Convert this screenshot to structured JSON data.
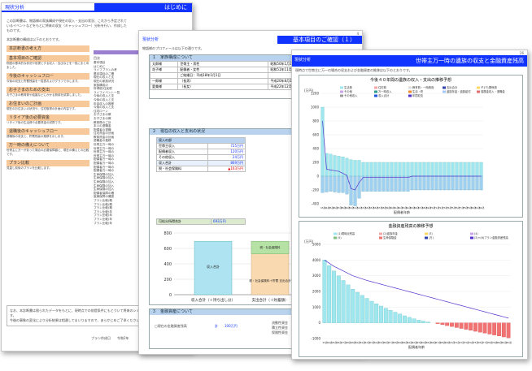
{
  "page1": {
    "tag": "現状分析",
    "title": "はじめに",
    "intro": "この診断書は、物語様の家族構成や現在の収入・支出の状況、これから予定されているイベントなどをもとに将来の収支（キャッシュフロー）分析を行い、作成したものです。",
    "toc_note": "本診断書の構成は以下のとおりです。",
    "sections": [
      {
        "h": "本診断書の考え方",
        "d": ""
      },
      {
        "h": "基本項目のご確認",
        "d": "物語の基本的な状況や前提とする収入・支出などを一覧にまとめました。"
      },
      {
        "h": "今後のキャッシュフロー",
        "d": "今後の収支と貯蓄残高を一覧表およびグラフで示します。"
      },
      {
        "h": "お子さまのための支出",
        "d": "お子さまの教育費や結婚などにかかる費用を試算しました。"
      },
      {
        "h": "お住まいのご計画",
        "d": "現在のお住まいの状況や、住宅取得の計画の内容です。"
      },
      {
        "h": "リタイア後の必要資金",
        "d": "リタイア後の生活費や必要資金の試算です。"
      },
      {
        "h": "退職後のキャッシュフロー",
        "d": "退職後の収支と、貯蓄残高の推移を示します。"
      },
      {
        "h": "万一時の備えについて",
        "d": "世帯主に万一があった場合の必要保障額と、現在の備えとの比較です。"
      },
      {
        "h": "プラン比較",
        "d": "見直し前後のプランを比較します。"
      }
    ],
    "footer1": "なお、本診断書は限られたデータをもとに、現時点での前提条件にもとづいて将来のシミュレーションを行ったものです。",
    "footer2": "今後の事象の変化により分析結果は相違してまいりますので、あらかじめご了承ください。",
    "planner": "プラン作成日　　令和2年",
    "midcol_title": "目次",
    "midcol": [
      "基本項目",
      "はじめに",
      "ライフプランの考",
      "基本項目のご確",
      "現在の収入と支",
      "現在の家族状況",
      "家族構成の",
      "所得税/住民税",
      "ライフイベント一覧",
      "今後の収入と支",
      "今後の収入と支",
      "年金収入の推移",
      "今後の収入と支",
      "住宅ローン",
      "お子さまの教",
      "お子さまの教",
      "教育費のご計",
      "本人の退職金",
      "配偶者の退職",
      "住宅資金の計画",
      "教育資金の計画",
      "退職金の推移",
      "世帯主万一時の",
      "世帯主万一時の",
      "世帯主万一時の",
      "世帯主万一時の",
      "配偶者万一時の",
      "配偶者万一時の",
      "配偶者万一時の",
      "配偶者万一時の",
      "生命保険の加入",
      "生命保険の加入",
      "生命保険の加入",
      "生命保険の加入",
      "生命保険の加入",
      "配偶者保障の確",
      "医療保障の確認",
      "プラン比較(概",
      "プラン比較(概",
      "プラン比較(概",
      "プラン比較(年",
      "プラン比較(年",
      "プラン比較(年",
      "プラン比較(年"
    ]
  },
  "page2": {
    "tag": "現状分析",
    "title": "基本項目のご確認（１）",
    "intro": "物語様のプロフィールは以下の通りです。",
    "sec1": "１　家族構成について",
    "family_rows": [
      [
        "太郎様",
        "世帯主・男性",
        "昭和50年1月10日生",
        "45"
      ],
      [
        "花子様",
        "配偶者・女性",
        "昭和51年11月25日生",
        "43"
      ],
      [
        "",
        "ご結婚日：平成18年1月1日",
        "",
        ""
      ],
      [
        "一郎様",
        "（長男）",
        "平成20年8月10日生",
        "1"
      ],
      [
        "愛美様",
        "（長女）",
        "平成22年12月19日生",
        "9"
      ]
    ],
    "sec2": "２　現在の収入と支出の状況",
    "income_header": "収入の部",
    "income": [
      [
        "世帯主収入",
        "725万円"
      ],
      [
        "配偶者収入",
        "120万円"
      ],
      [
        "その他収入",
        "24万円"
      ],
      [
        "収入合計",
        "869万円"
      ],
      [
        "税・社会保険料",
        "▲163万円"
      ]
    ],
    "disposable": [
      "可処分所得合計",
      "693万円"
    ],
    "expense_header": "支出の部",
    "expense": [
      "生活費",
      "住宅関連費",
      "住宅ローン返済",
      "支払保険料",
      "子ども関連費",
      "その他臨時支出",
      "その他支出",
      "年間予算",
      "支出合計"
    ],
    "expense_tail": [
      "支出合計(－",
      "貯蓄額",
      "貯蓄率"
    ],
    "expense_total_label": "支出合計(－",
    "bar_labels": {
      "income": "収入合計",
      "tax": "税・社会保険料",
      "tax_saving": "税・社会保険料＋貯蓄\n支出合計"
    },
    "axis_labels": [
      "収入合計（＋持ち出し分）",
      "支出合計（＋貯蓄額）"
    ],
    "sec3": "３　金融資産について",
    "assets_note": "□現在の金融資産残高",
    "assets_total": "計　　100万円",
    "assets_right": [
      "流動性資金",
      "積立性資金",
      "保険性資金"
    ],
    "page_no": "4"
  },
  "page3": {
    "tag": "現状分析",
    "title": "世帯主万一時の遺族の収支と金融資産残高",
    "intro": "現時点で世帯主に万一の場合の収支および金融資産の推移は以下のとおりです。",
    "page_no": "26",
    "chart1": {
      "title": "今後４０年間の遺族の収入・支出の推移予想",
      "ylabel": "(万円)",
      "xlabel": "配偶者年齢",
      "legend": [
        "生活費",
        "住宅費",
        "教育費・一時費用",
        "支出合計",
        "子ども関係費",
        "その他",
        "万一時収入",
        "生活・終",
        "遺族年金・遺族給付",
        "保険金収入・退職金",
        "その他収入",
        "収入合計",
        "年間収支"
      ],
      "yticks": [
        "1200",
        "1000",
        "800",
        "600",
        "400",
        "200",
        "0",
        "-200",
        "-400"
      ]
    },
    "chart2": {
      "title": "金融資産残高の推移予想",
      "ylabel": "(万円)",
      "xlabel": "配偶者年齢",
      "legend": [
        "(1)現時点残高",
        "(2)遺族年金",
        "(3)",
        "(4)",
        "(5)",
        "生命保険金",
        "(万)",
        "(5)+(6)プラン金融資産残高"
      ],
      "yticks": [
        "5000",
        "4000",
        "3000",
        "2000",
        "1000",
        "0",
        "-1000"
      ]
    }
  },
  "chart_data": [
    {
      "type": "bar",
      "title": "",
      "categories": [
        "収入合計（＋持ち出し分）",
        "支出合計（＋貯蓄額）"
      ],
      "ylim": [
        0,
        800
      ],
      "yticks": [
        0,
        200,
        400,
        600,
        800
      ],
      "series": [
        {
          "name": "収入合計",
          "values": [
            693,
            0
          ]
        },
        {
          "name": "税・社会保険料",
          "values": [
            163,
            0
          ]
        },
        {
          "name": "税・社会保険料＋貯蓄\n支出合計",
          "values": [
            0,
            693
          ]
        }
      ]
    },
    {
      "type": "bar",
      "title": "今後４０年間の遺族の収入・支出の推移予想",
      "xlabel": "配偶者年齢",
      "ylabel": "(万円)",
      "ylim": [
        -400,
        1200
      ],
      "x": [
        43,
        44,
        45,
        46,
        47,
        48,
        49,
        50,
        51,
        52,
        53,
        54,
        55,
        56,
        57,
        58,
        59,
        60,
        61,
        62,
        63,
        64,
        65,
        66,
        67,
        68,
        69,
        70,
        71,
        72,
        73,
        74,
        75,
        76,
        77,
        78,
        79,
        80,
        81,
        82
      ],
      "series": [
        {
          "name": "収入合計",
          "values": [
            1050,
            330,
            320,
            300,
            290,
            280,
            260,
            240,
            230,
            230,
            200,
            200,
            200,
            200,
            200,
            200,
            200,
            200,
            200,
            200,
            200,
            200,
            200,
            200,
            200,
            200,
            200,
            200,
            200,
            200,
            200,
            200,
            200,
            200,
            200,
            200,
            200,
            200,
            200,
            200
          ]
        },
        {
          "name": "支出合計",
          "values": [
            -240,
            -230,
            -220,
            -230,
            -240,
            -240,
            -260,
            -420,
            -430,
            -320,
            -220,
            -220,
            -220,
            -220,
            -220,
            -220,
            -220,
            -220,
            -220,
            -220,
            -220,
            -220,
            -200,
            -200,
            -200,
            -200,
            -200,
            -200,
            -200,
            -200,
            -200,
            -200,
            -200,
            -200,
            -200,
            -200,
            -200,
            -200,
            -200,
            -200
          ]
        },
        {
          "name": "年間収支",
          "values": [
            800,
            100,
            90,
            80,
            70,
            40,
            10,
            -180,
            -200,
            -90,
            -20,
            -20,
            -20,
            -20,
            -20,
            -20,
            -20,
            -20,
            -20,
            -20,
            -20,
            -20,
            0,
            0,
            0,
            0,
            0,
            0,
            0,
            0,
            0,
            0,
            0,
            0,
            0,
            0,
            0,
            0,
            0,
            0
          ]
        }
      ]
    },
    {
      "type": "bar",
      "title": "金融資産残高の推移予想",
      "xlabel": "配偶者年齢",
      "ylabel": "(万円)",
      "ylim": [
        -1000,
        5000
      ],
      "x": [
        43,
        44,
        45,
        46,
        47,
        48,
        49,
        50,
        51,
        52,
        53,
        54,
        55,
        56,
        57,
        58,
        59,
        60,
        61,
        62,
        63,
        64,
        65,
        66,
        67,
        68,
        69,
        70,
        71,
        72,
        73,
        74,
        75,
        76,
        77,
        78,
        79,
        80,
        81,
        82
      ],
      "series": [
        {
          "name": "金融資産残高",
          "values": [
            4000,
            3650,
            3300,
            3000,
            2700,
            2420,
            2150,
            1950,
            1750,
            1560,
            1380,
            1220,
            1070,
            930,
            800,
            680,
            560,
            450,
            350,
            260,
            180,
            110,
            50,
            0,
            -60,
            -120,
            -180,
            -240,
            -300,
            -360,
            -420,
            -480,
            -540,
            -600,
            -660,
            -720,
            -780,
            -840,
            -900,
            -960
          ]
        },
        {
          "name": "(5)+(6)プラン金融資産残高",
          "values": [
            4000,
            3800,
            3600,
            3450,
            3300,
            3150,
            3000,
            2900,
            2800,
            2700,
            2620,
            2540,
            2460,
            2380,
            2300,
            2220,
            2140,
            2060,
            1980,
            1900,
            1820,
            1740,
            1660,
            1580,
            1500,
            1420,
            1340,
            1260,
            1180,
            1100,
            1020,
            940,
            860,
            780,
            700,
            620,
            540,
            460,
            380,
            300
          ]
        }
      ]
    }
  ]
}
